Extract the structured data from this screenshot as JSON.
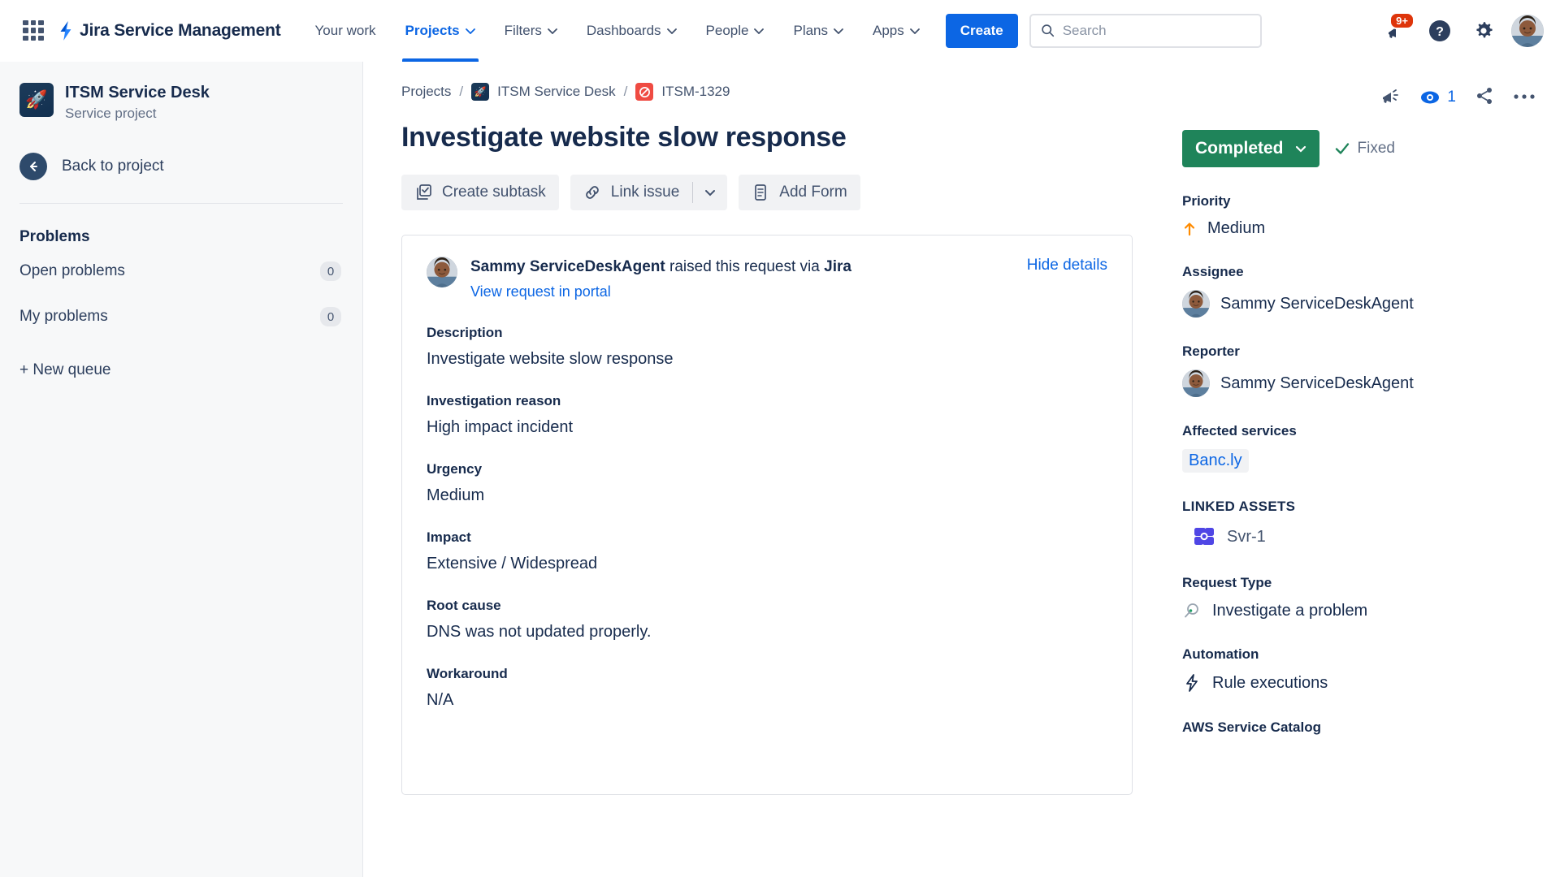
{
  "nav": {
    "product_name": "Jira Service Management",
    "items": [
      {
        "label": "Your work",
        "has_caret": false,
        "active": false
      },
      {
        "label": "Projects",
        "has_caret": true,
        "active": true
      },
      {
        "label": "Filters",
        "has_caret": true,
        "active": false
      },
      {
        "label": "Dashboards",
        "has_caret": true,
        "active": false
      },
      {
        "label": "People",
        "has_caret": true,
        "active": false
      },
      {
        "label": "Plans",
        "has_caret": true,
        "active": false
      },
      {
        "label": "Apps",
        "has_caret": true,
        "active": false
      }
    ],
    "create_label": "Create",
    "search_placeholder": "Search",
    "search_value": "",
    "notification_badge": "9+"
  },
  "sidebar": {
    "project_name": "ITSM Service Desk",
    "project_type": "Service project",
    "back_label": "Back to project",
    "section_title": "Problems",
    "queues": [
      {
        "label": "Open problems",
        "count": "0"
      },
      {
        "label": "My problems",
        "count": "0"
      }
    ],
    "new_queue_label": "+ New queue"
  },
  "breadcrumb": {
    "projects": "Projects",
    "project": "ITSM Service Desk",
    "issue_key": "ITSM-1329",
    "separator": "/"
  },
  "issue": {
    "title": "Investigate website slow response",
    "actions": {
      "create_subtask": "Create subtask",
      "link_issue": "Link issue",
      "add_form": "Add Form"
    }
  },
  "details_card": {
    "raiser_name": "Sammy ServiceDeskAgent",
    "raised_text": "raised this request via",
    "channel": "Jira",
    "portal_link": "View request in portal",
    "hide_details": "Hide details",
    "fields": [
      {
        "label": "Description",
        "value": "Investigate website slow response"
      },
      {
        "label": "Investigation reason",
        "value": "High impact incident"
      },
      {
        "label": "Urgency",
        "value": "Medium"
      },
      {
        "label": "Impact",
        "value": "Extensive / Widespread"
      },
      {
        "label": "Root cause",
        "value": "DNS was not updated properly."
      },
      {
        "label": "Workaround",
        "value": "N/A"
      }
    ]
  },
  "right_panel": {
    "watch_count": "1",
    "status": "Completed",
    "resolution": "Fixed",
    "priority_label": "Priority",
    "priority_value": "Medium",
    "assignee_label": "Assignee",
    "assignee_value": "Sammy ServiceDeskAgent",
    "reporter_label": "Reporter",
    "reporter_value": "Sammy ServiceDeskAgent",
    "affected_services_label": "Affected services",
    "affected_services_value": "Banc.ly",
    "linked_assets_label": "LINKED ASSETS",
    "linked_assets_value": "Svr-1",
    "request_type_label": "Request Type",
    "request_type_value": "Investigate a problem",
    "automation_label": "Automation",
    "automation_value": "Rule executions",
    "aws_label": "AWS Service Catalog"
  },
  "colors": {
    "brand_blue": "#0c66e4",
    "status_green": "#1f845a",
    "priority_orange": "#ff8b00",
    "badge_red": "#de350b",
    "asset_purple": "#4f46e5",
    "text_dark": "#172b4d"
  }
}
